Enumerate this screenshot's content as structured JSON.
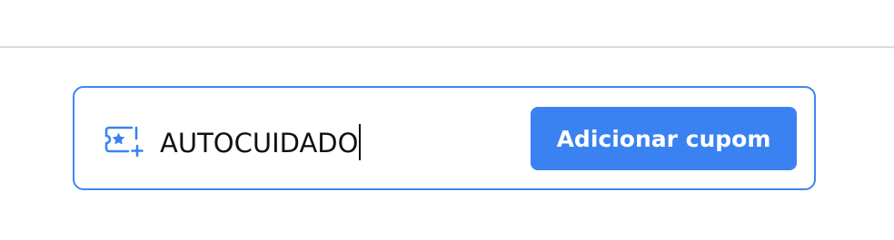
{
  "coupon": {
    "icon": "ticket-star-plus-icon",
    "input_value": "AUTOCUIDADO",
    "button_label": "Adicionar cupom",
    "accent_color": "#3a82f1"
  }
}
